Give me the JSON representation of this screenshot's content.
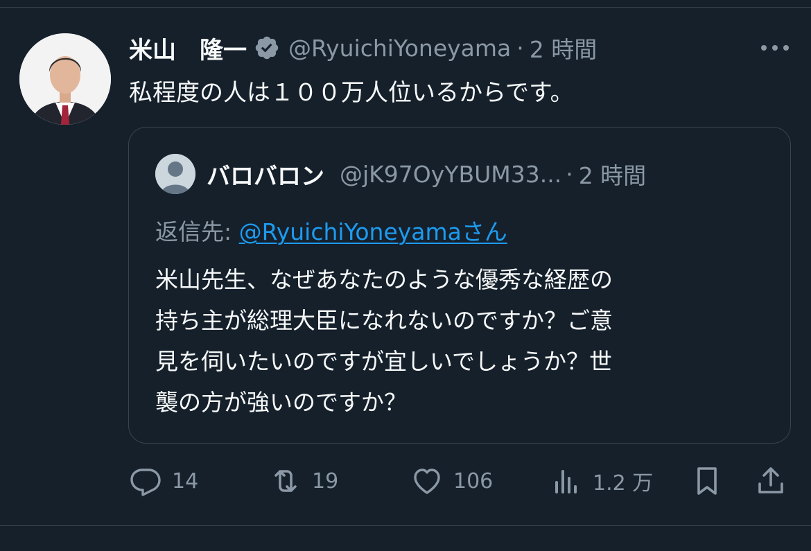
{
  "tweet": {
    "author_name": "米山　隆一",
    "author_handle": "@RyuichiYoneyama",
    "time": "2 時間",
    "text": "私程度の人は１００万人位いるからです。"
  },
  "quote": {
    "author_name": "バロバロン",
    "author_handle": "@jK97OyYBUM33...",
    "time": "2 時間",
    "reply_label": "返信先: ",
    "reply_to": "@RyuichiYoneyamaさん",
    "lines": [
      "米山先生、なぜあなたのような優秀な経歴の",
      "持ち主が総理大臣になれないのですか？ご意",
      "見を伺いたいのですが宜しいでしょうか？世",
      "襲の方が強いのですか？"
    ]
  },
  "actions": {
    "replies": "14",
    "retweets": "19",
    "likes": "106",
    "views": "1.2 万"
  },
  "colors": {
    "background": "#15202b",
    "text": "#f7f9f9",
    "secondary": "#8b98a5",
    "link": "#1d9bf0",
    "border": "#38444d"
  },
  "icons": [
    "verified-badge-icon",
    "more-icon",
    "reply-icon",
    "retweet-icon",
    "like-icon",
    "views-icon",
    "bookmark-icon",
    "share-icon"
  ]
}
